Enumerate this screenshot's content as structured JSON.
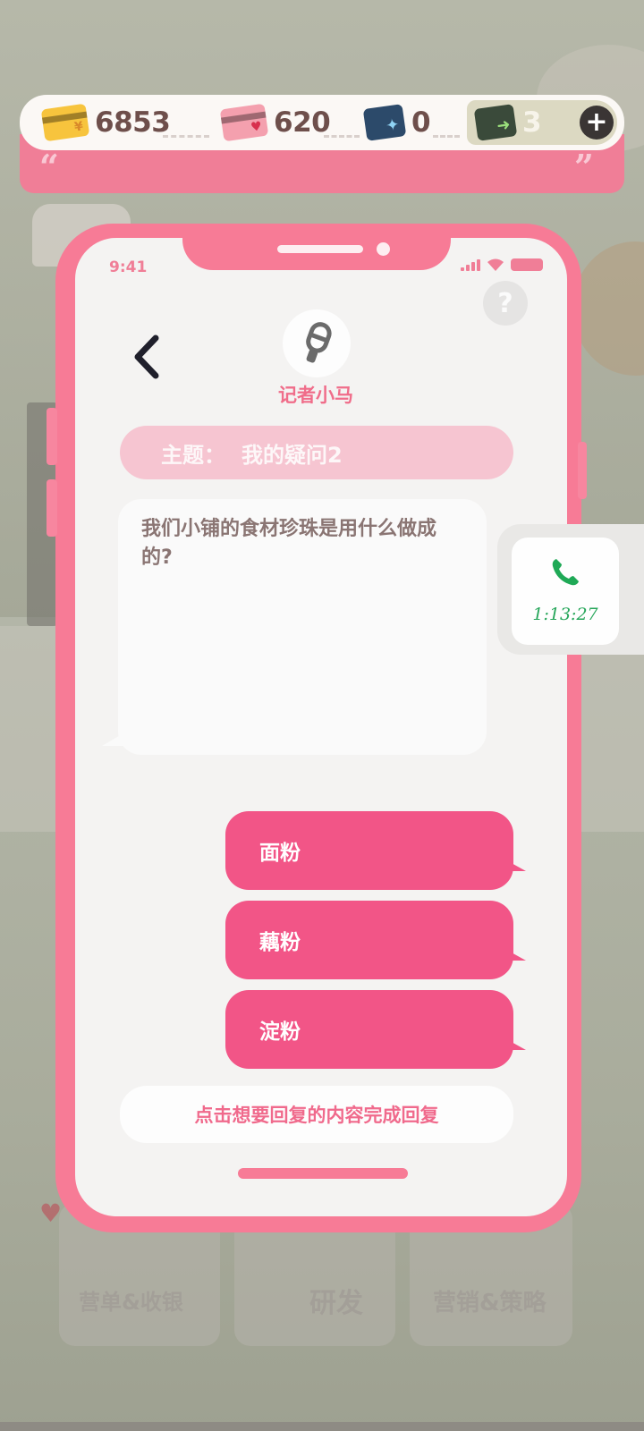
{
  "currency": {
    "gold_card": {
      "value": "6853",
      "icon": "gold-card-icon",
      "symbol": "¥",
      "color": "#f7c43d"
    },
    "love_card": {
      "value": "620",
      "icon": "love-card-icon",
      "symbol": "♥",
      "color": "#f4a0ae"
    },
    "sparkle_ticket": {
      "value": "0",
      "icon": "sparkle-ticket-icon",
      "symbol": "✦",
      "color": "#2c4a6a"
    },
    "green_ticket": {
      "value": "3",
      "icon": "green-ticket-icon",
      "symbol": "➜",
      "color": "#3a4a3a"
    },
    "add_icon": "plus-icon",
    "add_label": "+"
  },
  "phone": {
    "status_time": "9:41",
    "help_label": "?",
    "contact_name": "记者小马",
    "topic_label": "主题：",
    "topic_value": "我的疑问2",
    "message": "我们小铺的食材珍珠是用什么做成的?",
    "options": [
      "面粉",
      "藕粉",
      "淀粉"
    ],
    "hint": "点击想要回复的内容完成回复"
  },
  "call": {
    "icon": "phone-icon",
    "timer": "1:13:27"
  },
  "background": {
    "bottom_left_label": "营单&收银",
    "bottom_center_label": "研发",
    "bottom_right_label": "营销&策略"
  },
  "colors": {
    "phone_frame": "#f77b96",
    "option_button": "#f25587",
    "topic_pill": "#f6c5d1",
    "call_green": "#26a65a"
  }
}
